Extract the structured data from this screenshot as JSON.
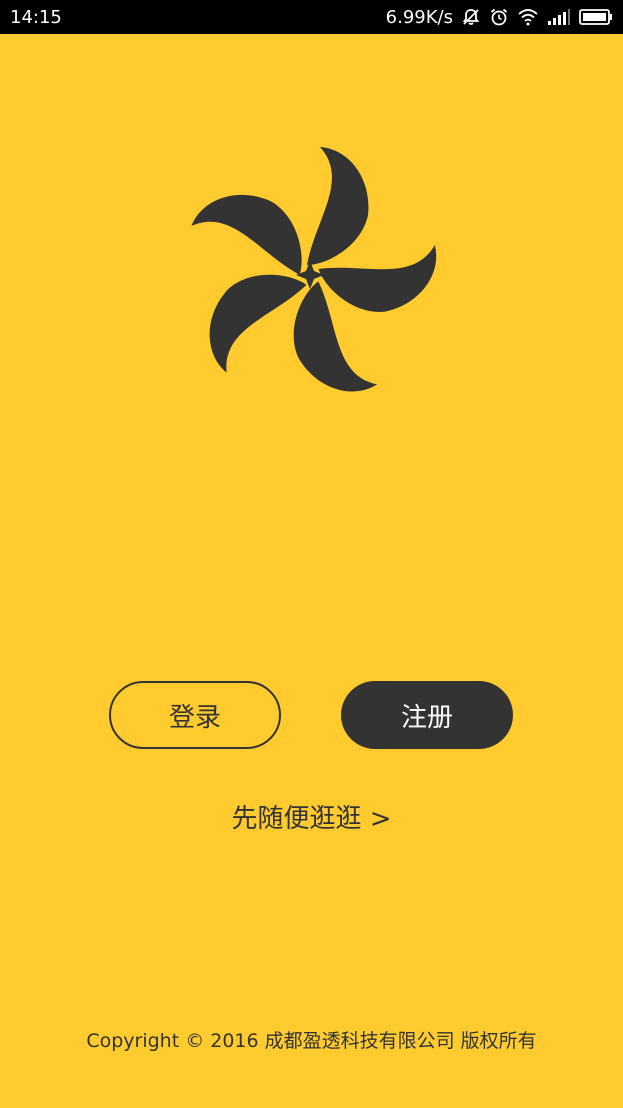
{
  "status_bar": {
    "time": "14:15",
    "network_speed": "6.99K/s",
    "icons": [
      "notifications-off-icon",
      "alarm-icon",
      "wifi-icon",
      "signal-icon",
      "battery-icon"
    ]
  },
  "logo": {
    "name": "app-logo-pinwheel",
    "color": "#333333"
  },
  "buttons": {
    "login": "登录",
    "register": "注册"
  },
  "browse_link": "先随便逛逛 >",
  "footer": {
    "copyright": "Copyright © 2016 成都盈透科技有限公司 版权所有"
  },
  "colors": {
    "background": "#FFCB2F",
    "dark": "#333333",
    "status_bar": "#000000"
  }
}
